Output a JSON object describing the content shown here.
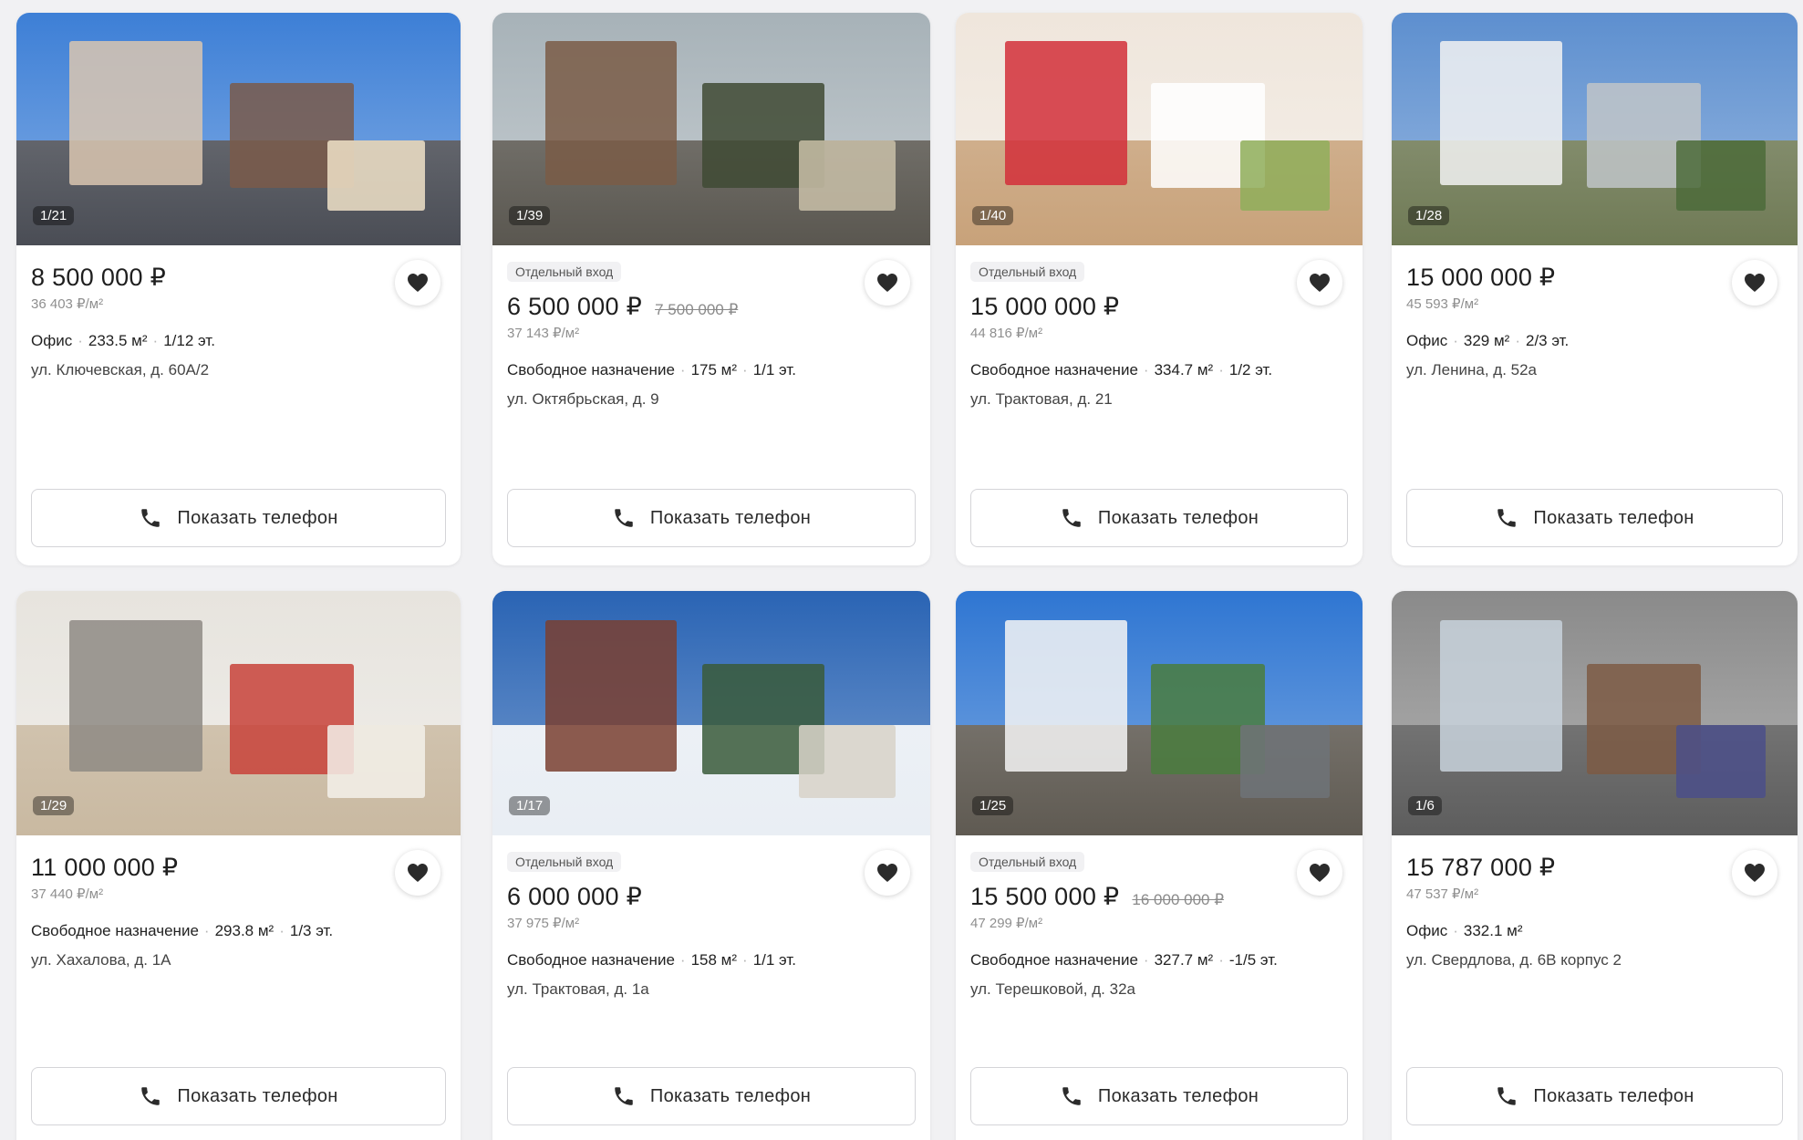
{
  "phone_button_label": "Показать телефон",
  "colors": {
    "accent": "#1f1f1f",
    "muted": "#8f8f8f",
    "border": "#d4d4d8"
  },
  "icons": {
    "favorite": "heart-icon",
    "phone": "phone-icon"
  },
  "listings": [
    {
      "photo_counter": "1/21",
      "badge": "",
      "price": "8 500 000 ₽",
      "old_price": "",
      "price_per_m2": "36 403 ₽/м²",
      "type": "Офис",
      "area": "233.5 м²",
      "floor": "1/12 эт.",
      "address": "ул. Ключевская, д. 60А/2"
    },
    {
      "photo_counter": "1/39",
      "badge": "Отдельный вход",
      "price": "6 500 000 ₽",
      "old_price": "7 500 000 ₽",
      "price_per_m2": "37 143 ₽/м²",
      "type": "Свободное назначение",
      "area": "175 м²",
      "floor": "1/1 эт.",
      "address": "ул. Октябрьская, д. 9"
    },
    {
      "photo_counter": "1/40",
      "badge": "Отдельный вход",
      "price": "15 000 000 ₽",
      "old_price": "",
      "price_per_m2": "44 816 ₽/м²",
      "type": "Свободное назначение",
      "area": "334.7 м²",
      "floor": "1/2 эт.",
      "address": "ул. Трактовая, д. 21"
    },
    {
      "photo_counter": "1/28",
      "badge": "",
      "price": "15 000 000 ₽",
      "old_price": "",
      "price_per_m2": "45 593 ₽/м²",
      "type": "Офис",
      "area": "329 м²",
      "floor": "2/3 эт.",
      "address": "ул. Ленина, д. 52а"
    },
    {
      "photo_counter": "1/29",
      "badge": "",
      "price": "11 000 000 ₽",
      "old_price": "",
      "price_per_m2": "37 440 ₽/м²",
      "type": "Свободное назначение",
      "area": "293.8 м²",
      "floor": "1/3 эт.",
      "address": "ул. Хахалова, д. 1А"
    },
    {
      "photo_counter": "1/17",
      "badge": "Отдельный вход",
      "price": "6 000 000 ₽",
      "old_price": "",
      "price_per_m2": "37 975 ₽/м²",
      "type": "Свободное назначение",
      "area": "158 м²",
      "floor": "1/1 эт.",
      "address": "ул. Трактовая, д. 1а"
    },
    {
      "photo_counter": "1/25",
      "badge": "Отдельный вход",
      "price": "15 500 000 ₽",
      "old_price": "16 000 000 ₽",
      "price_per_m2": "47 299 ₽/м²",
      "type": "Свободное назначение",
      "area": "327.7 м²",
      "floor": "-1/5 эт.",
      "address": "ул. Терешковой, д. 32а"
    },
    {
      "photo_counter": "1/6",
      "badge": "",
      "price": "15 787 000 ₽",
      "old_price": "",
      "price_per_m2": "47 537 ₽/м²",
      "type": "Офис",
      "area": "332.1 м²",
      "floor": "",
      "address": "ул. Свердлова, д. 6В корпус 2"
    }
  ]
}
